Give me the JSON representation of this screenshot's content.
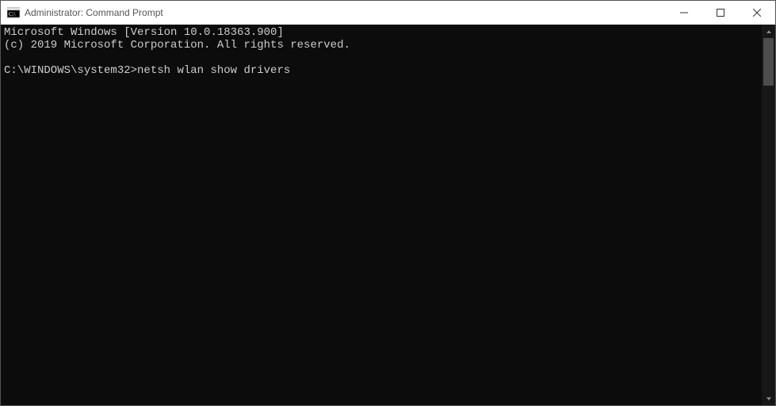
{
  "titlebar": {
    "title": "Administrator: Command Prompt"
  },
  "terminal": {
    "line1": "Microsoft Windows [Version 10.0.18363.900]",
    "line2": "(c) 2019 Microsoft Corporation. All rights reserved.",
    "blank": "",
    "prompt": "C:\\WINDOWS\\system32>",
    "command": "netsh wlan show drivers"
  }
}
